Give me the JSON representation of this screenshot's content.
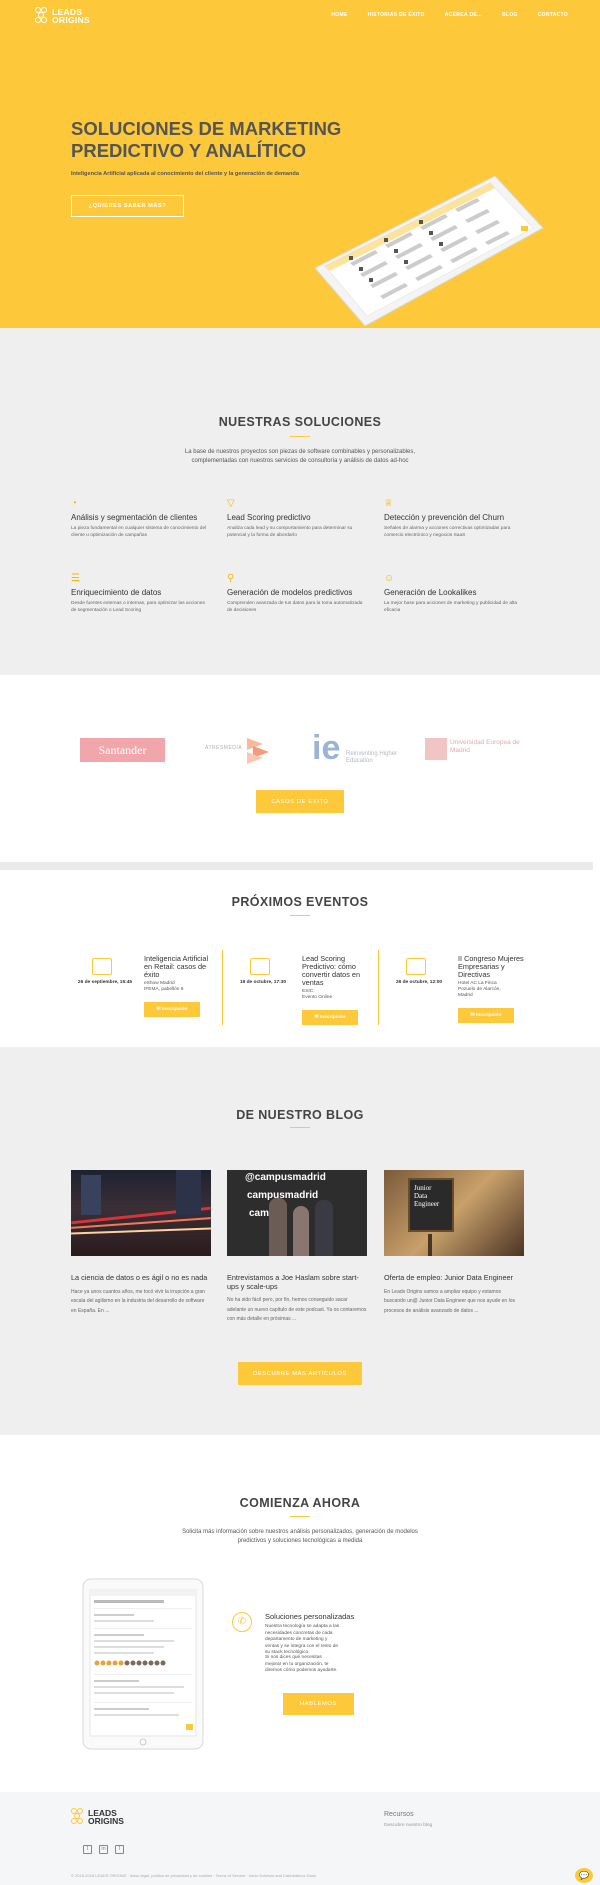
{
  "logo": {
    "line1": "LEADS",
    "line2": "ORIGINS"
  },
  "nav": [
    "HOME",
    "HISTORIAS DE ÉXITO",
    "ACERCA DE...",
    "BLOG",
    "CONTACTO"
  ],
  "hero": {
    "title": "SOLUCIONES DE MARKETING PREDICTIVO Y ANALÍTICO",
    "subtitle": "Inteligencia Artificial aplicada al conocimiento del cliente y la generación de demanda",
    "button": "¿QUIERES SABER MÁS?"
  },
  "solutions": {
    "title": "NUESTRAS SOLUCIONES",
    "intro": "La base de nuestros proyectos son piezas de software combinables y personalizables, complementadas con nuestros servicios de consultoría y análisis de datos ad-hoc",
    "items": [
      {
        "icon": "pie-chart-icon",
        "title": "Análisis y segmentación de clientes",
        "text": "La pieza fundamental en cualquier sistema de conocimiento del cliente u optimización de campañas"
      },
      {
        "icon": "funnel-icon",
        "title": "Lead Scoring predictivo",
        "text": "Analiza cada lead y su comportamiento para determinar su potencial y la forma de abordarlo"
      },
      {
        "icon": "trophy-icon",
        "title": "Detección y prevención del Churn",
        "text": "Señales de alarma y acciones correctivas optimizadas para comercio electrónico y negocios SaaS"
      },
      {
        "icon": "database-icon",
        "title": "Enriquecimiento de datos",
        "text": "Desde fuentes externas o internas, para optimizar las acciones de segmentación o Lead Scoring"
      },
      {
        "icon": "stethoscope-icon",
        "title": "Generación de modelos predictivos",
        "text": "Comprenden avanzada de tus datos para la toma automatizada de decisiones"
      },
      {
        "icon": "users-icon",
        "title": "Generación de Lookalikes",
        "text": "La mejor base para acciones de marketing y publicidad de alta eficacia"
      }
    ]
  },
  "clients": {
    "logos": [
      "Santander",
      "ATRESMEDIA",
      "ie",
      "Reinventing Higher Education",
      "Universidad Europea de Madrid"
    ],
    "button": "CASOS DE ÉXITO"
  },
  "events": {
    "title": "PRÓXIMOS EVENTOS",
    "items": [
      {
        "date": "26 de septiembre, 15:45",
        "title": "Inteligencia Artificial en Retail: casos de éxito",
        "location": [
          "eShow Madrid",
          "IFEMA, pabellón 8"
        ],
        "button": "Inscripción"
      },
      {
        "date": "19 de octubre, 17:30",
        "title": "Lead Scoring Predictivo: cómo convertir datos en ventas",
        "location": [
          "ESIC",
          "Evento Online"
        ],
        "button": "Inscripción"
      },
      {
        "date": "26 de octubre, 12:00",
        "title": "II Congreso Mujeres Empresarias y Directivas",
        "location": [
          "Hotel AC La Finca",
          "Pozuelo de Alarcón, Madrid"
        ],
        "button": "Inscripción"
      }
    ]
  },
  "blog": {
    "title": "DE NUESTRO BLOG",
    "posts": [
      {
        "title": "La ciencia de datos o es ágil o no es nada",
        "excerpt": "Hace ya unos cuantos años, me tocó vivir la irrupción a gran escala del agilismo en la industria del desarrollo de software en España. En ..."
      },
      {
        "title": "Entrevistamos a Joe Haslam sobre start-ups y scale-ups",
        "excerpt": "No ha sido fácil pero, por fin, hemos conseguido sacar adelante un nuevo capítulo de este podcast. Ya os contaremos con más detalle en próximas ..."
      },
      {
        "title": "Oferta de empleo: Junior Data Engineer",
        "excerpt": "En Leads Origins vamos a ampliar equipo y estamos buscando un@ Junior Data Engineer que nos ayude en los procesos de análisis avanzado de datos ..."
      }
    ],
    "img2_text": [
      "@campusmadrid",
      "campusmadrid",
      "campus"
    ],
    "img3_text": [
      "Junior",
      "Data",
      "Engineer"
    ],
    "button": "DESCUBRE MÁS ARTÍCULOS"
  },
  "start": {
    "title": "COMIENZA AHORA",
    "intro": "Solicita más información sobre nuestros análisis personalizados, generación de modelos predictivos y soluciones tecnológicas a medida",
    "feature_title": "Soluciones personalizadas",
    "feature_text1": "Nuestra tecnología se adapta a las necesidades concretas de cada departamento de marketing y ventas y se integra con el resto de su stack tecnológico.",
    "feature_text2": "Si nos dices qué necesitas mejorar en tu organización, te diremos cómo podemos ayudarte.",
    "button": "HABLEMOS"
  },
  "footer": {
    "resources_title": "Recursos",
    "resources_link": "Descubre nuestro blog",
    "copyright": "© 2015-2018 LEADS ORIGINS · Aviso legal, política de privacidad y de cookies · Terms of Service · Inicio Echevar and Catedraticos Dado"
  },
  "colors": {
    "accent": "#fdc83a",
    "text": "#555555",
    "gray_bg": "#efefef"
  }
}
